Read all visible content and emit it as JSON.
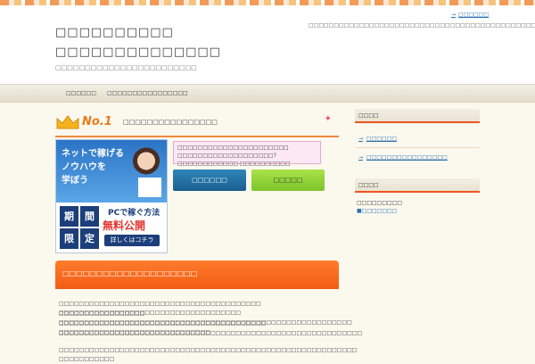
{
  "header": {
    "title_line1": "□□□□□□□□□□",
    "title_line2": "□□□□□□□□□□□□□□",
    "subtitle": "□□□□□□□□□□□□□□□□□□□□□□□□",
    "description": "□□□□□□□□□□□□□□□□□□□□□□□□□□□□□□□□□□□□□□□□□□□□□□□□□",
    "top_link": "□□□□□□"
  },
  "nav": {
    "items": [
      "□□□□□□",
      "□□□□□□□□□□□□□□□□"
    ]
  },
  "ranking": {
    "badge": "No.1",
    "label": "□□□□□□□□□□□□□□□□"
  },
  "banner": {
    "line1": "ネットで稼げる",
    "line2": "ノウハウを",
    "line3": "学ぼう",
    "box": [
      "期",
      "間",
      "限",
      "定"
    ],
    "pc_text": "PCで稼ぐ方法",
    "free_text": "無料公開",
    "button_text": "詳しくはコチラ"
  },
  "notice": {
    "text": "□□□□□□□□□□□□□□□□□□□□□□ □□□□□□□□□□□□□□□□□□□?□□□□□□□□□□□□ □□□□□□□□□□"
  },
  "buttons": {
    "blue": "□□□□□□",
    "green": "□□□□□"
  },
  "section": {
    "heading": "□□□□□□□□□□□□□□□□□□□□",
    "paragraph1_line1": "□□□□□□□□□□□□□□□□□□□□□□□□□□□□□□□□□□□□□□□□ □□□□□□□□□□□□□□□□□□□□□□□□□□□□□□□□□□□□",
    "paragraph1_line2": "□□□□□□□□□□□□□□□□□ □□□□□□□□□□□□□□□□□□□□□□□□□□□□□□□□□□□□□□□□□□□□□□□□□□□□□□□□□□",
    "paragraph1_line3": "□□□□□□□□□□□□□□□□□□□□□□□□□□□□□□□□□□□□□□□□□ □□□□□□□□□□□□□□□□□□□□□□□□□□□□□□",
    "paragraph1_line4": "□□□□□□□□□□□□□□□□□□□□□□□□□□□□□□□□□□□□□□□□□□□□□□□□□□□□□□□□□□□□",
    "paragraph2_line1": "□□□□□□□□□□□□□□□□□□□□□□□□□□□□□□□□□□□□□□□□□□□□□□□□□□□□□□□□□□□ □□□□□□□□□□□"
  },
  "sidebar": {
    "widget1_title": "□□□□",
    "widget1_links": [
      "□□□□□□",
      "□□□□□□□□□□□□□□□□"
    ],
    "widget2_title": "□□□□",
    "widget2_text1": "□□□□□□□□□",
    "widget2_text2": "■□□□□□□□"
  },
  "colors": {
    "accent_orange": "#f25d14",
    "link_blue": "#2a6fb1",
    "button_blue": "#1a5f90",
    "button_green": "#7cc42a"
  }
}
